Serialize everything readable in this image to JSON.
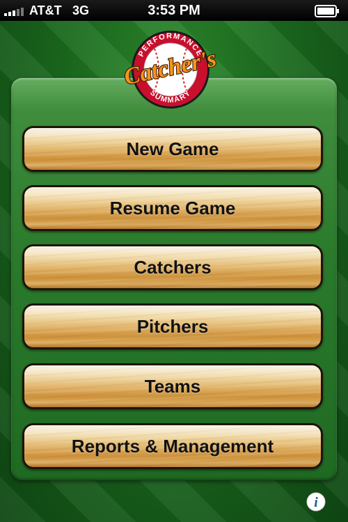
{
  "status_bar": {
    "carrier": "AT&T",
    "network": "3G",
    "time": "3:53 PM",
    "signal_icon": "signal-bars-icon",
    "battery_icon": "battery-icon"
  },
  "logo": {
    "top_text": "PERFORMANCE",
    "main_text": "Catcher's",
    "bottom_text": "SUMMARY",
    "colors": {
      "ring": "#c8102e",
      "script": "#f7941d",
      "ball": "#ffffff"
    }
  },
  "menu": {
    "new_game": "New Game",
    "resume_game": "Resume Game",
    "catchers": "Catchers",
    "pitchers": "Pitchers",
    "teams": "Teams",
    "reports": "Reports & Management"
  },
  "info_button": {
    "icon": "info-icon",
    "glyph": "i"
  },
  "colors": {
    "field_green": "#1b6b1f",
    "panel_green": "#2a7a2c",
    "wood": "#e2b56c",
    "button_border": "#1e1408"
  }
}
